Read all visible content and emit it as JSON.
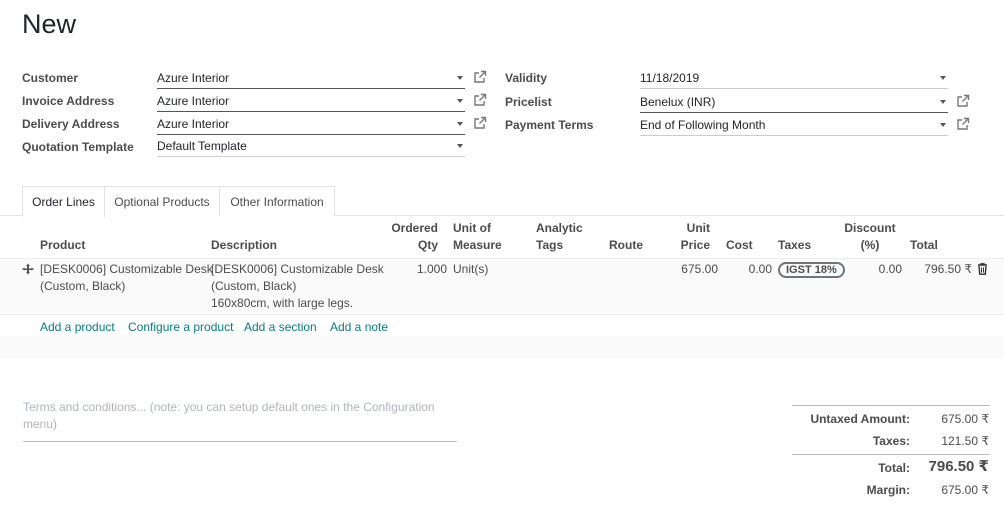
{
  "title": "New",
  "form": {
    "customer_label": "Customer",
    "customer": "Azure Interior",
    "invoice_label": "Invoice Address",
    "invoice": "Azure Interior",
    "delivery_label": "Delivery Address",
    "delivery": "Azure Interior",
    "template_label": "Quotation Template",
    "template": "Default Template",
    "validity_label": "Validity",
    "validity": "11/18/2019",
    "pricelist_label": "Pricelist",
    "pricelist": "Benelux (INR)",
    "payment_label": "Payment Terms",
    "payment": "End of Following Month"
  },
  "tabs": [
    "Order Lines",
    "Optional Products",
    "Other Information"
  ],
  "table": {
    "headers": {
      "product": "Product",
      "description": "Description",
      "qty_1": "Ordered",
      "qty_2": "Qty",
      "uom_1": "Unit of",
      "uom_2": "Measure",
      "analytic_1": "Analytic",
      "analytic_2": "Tags",
      "route": "Route",
      "price_1": "Unit",
      "price_2": "Price",
      "cost": "Cost",
      "taxes": "Taxes",
      "discount_1": "Discount",
      "discount_2": "(%)",
      "total": "Total"
    },
    "row": {
      "product_1": "[DESK0006] Customizable Desk",
      "product_2": "(Custom, Black)",
      "desc_1": "[DESK0006] Customizable Desk",
      "desc_2": "(Custom, Black)",
      "desc_3": "160x80cm, with large legs.",
      "qty": "1.000",
      "uom": "Unit(s)",
      "price": "675.00",
      "cost": "0.00",
      "tax": "IGST 18%",
      "discount": "0.00",
      "total": "796.50 ₹"
    },
    "actions": {
      "add_product": "Add a product",
      "configure_product": "Configure a product",
      "add_section": "Add a section",
      "add_note": "Add a note"
    }
  },
  "terms_placeholder_1": "Terms and conditions... (note: you can setup default ones in the Configuration",
  "terms_placeholder_2": "menu)",
  "totals": {
    "untaxed_label": "Untaxed Amount:",
    "untaxed": "675.00 ₹",
    "taxes_label": "Taxes:",
    "taxes": "121.50 ₹",
    "total_label": "Total:",
    "total": "796.50 ₹",
    "margin_label": "Margin:",
    "margin": "675.00 ₹"
  },
  "colors": {
    "link": "#017e84",
    "text": "#4c4c4c"
  }
}
